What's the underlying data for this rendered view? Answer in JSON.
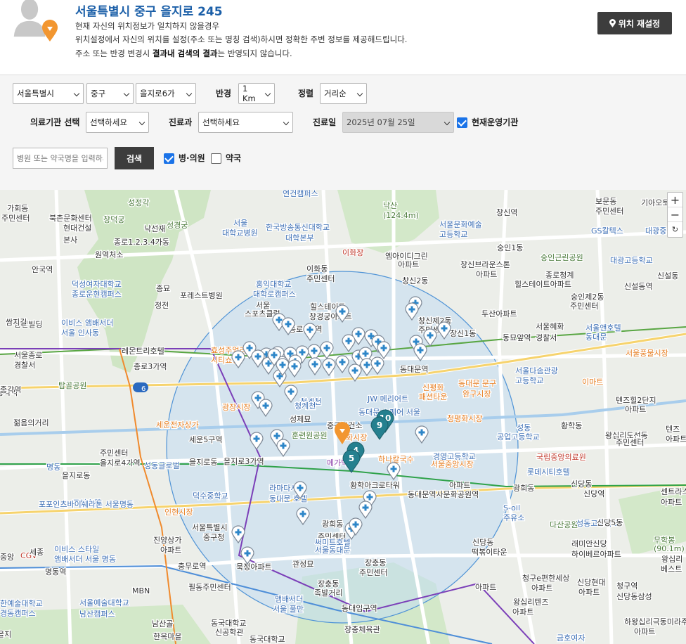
{
  "location": {
    "address": "서울특별시 중구 을지로 245",
    "line1": "현재 자신의 위치정보가 일치하지 않을경우",
    "line2": "위치설정에서 자신의 위치를 설정(주소 또는 명칭 검색)하시면 정확한 주변 정보를 제공해드립니다.",
    "line3_pre": "주소 또는 반경 변경시 ",
    "line3_bold": "결과내 검색의 결과",
    "line3_post": "는 반영되지 않습니다.",
    "reset_label": "위치 재설정"
  },
  "filters": {
    "sido": "서울특별시",
    "sigungu": "중구",
    "dong": "을지로6가",
    "radius_label": "반경",
    "radius": "1 Km",
    "sort_label": "정렬",
    "sort": "거리순",
    "institution_label": "의료기관 선택",
    "institution": "선택하세요",
    "dept_label": "진료과",
    "dept": "선택하세요",
    "date_label": "진료일",
    "date": "2025년 07월 25일",
    "operating_label": "현재운영기관",
    "search_placeholder": "병원 또는 약국명을 입력하세요",
    "search_button": "검색",
    "hospital_label": "병·의원",
    "pharmacy_label": "약국"
  },
  "map": {
    "zoom_in": "+",
    "zoom_out": "−",
    "reset": "↻",
    "labels": [
      {
        "t": "연건캠퍼스",
        "c": "#3d6fb5"
      },
      {
        "t": "낙산",
        "c": "#4a7a3a"
      },
      {
        "t": "(124.4m)",
        "c": "#4a7a3a"
      },
      {
        "t": "창신역",
        "c": "#333"
      },
      {
        "t": "보문동",
        "c": "#333"
      },
      {
        "t": "주민센터",
        "c": "#333"
      },
      {
        "t": "기아오토",
        "c": "#333"
      },
      {
        "t": "가회동",
        "c": "#333"
      },
      {
        "t": "주민센터",
        "c": "#333"
      },
      {
        "t": "성정각",
        "c": "#4a7a3a"
      },
      {
        "t": "창덕궁",
        "c": "#4a7a3a"
      },
      {
        "t": "북촌문화센터",
        "c": "#333"
      },
      {
        "t": "현대건설",
        "c": "#333"
      },
      {
        "t": "본사",
        "c": "#333"
      },
      {
        "t": "낙선재",
        "c": "#333"
      },
      {
        "t": "성경궁",
        "c": "#4a7a3a"
      },
      {
        "t": "서울",
        "c": "#3d6fb5"
      },
      {
        "t": "대학교병원",
        "c": "#3d6fb5"
      },
      {
        "t": "한국방송통신대학교",
        "c": "#3d6fb5"
      },
      {
        "t": "대학본부",
        "c": "#3d6fb5"
      },
      {
        "t": "서울문화예술",
        "c": "#3d6fb5"
      },
      {
        "t": "고등학교",
        "c": "#3d6fb5"
      },
      {
        "t": "숭인1동",
        "c": "#333"
      },
      {
        "t": "GS칼텍스",
        "c": "#3d6fb5"
      },
      {
        "t": "대광중",
        "c": "#3d6fb5"
      },
      {
        "t": "원역처소",
        "c": "#333"
      },
      {
        "t": "종로1.2.3.4가동",
        "c": "#333"
      },
      {
        "t": "이화장",
        "c": "#c0392b"
      },
      {
        "t": "엠아이디그린",
        "c": "#333"
      },
      {
        "t": "아파트",
        "c": "#333"
      },
      {
        "t": "창신브라운스톤",
        "c": "#333"
      },
      {
        "t": "아파트",
        "c": "#333"
      },
      {
        "t": "숭인근린공원",
        "c": "#4a7a3a"
      },
      {
        "t": "대광고등학교",
        "c": "#3d6fb5"
      },
      {
        "t": "안국역",
        "c": "#333"
      },
      {
        "t": "이화동",
        "c": "#333"
      },
      {
        "t": "주민센터",
        "c": "#333"
      },
      {
        "t": "창신2동",
        "c": "#333"
      },
      {
        "t": "힐스테이트아파트",
        "c": "#333"
      },
      {
        "t": "종로청계",
        "c": "#333"
      },
      {
        "t": "신설동역",
        "c": "#333"
      },
      {
        "t": "신설동",
        "c": "#333"
      },
      {
        "t": "덕성여자대학교",
        "c": "#3d6fb5"
      },
      {
        "t": "종로운현캠퍼스",
        "c": "#3d6fb5"
      },
      {
        "t": "종묘",
        "c": "#333"
      },
      {
        "t": "포레스트병원",
        "c": "#333"
      },
      {
        "t": "홍익대학교",
        "c": "#3d6fb5"
      },
      {
        "t": "대학로캠퍼스",
        "c": "#3d6fb5"
      },
      {
        "t": "숭인제2동",
        "c": "#333"
      },
      {
        "t": "주민센터",
        "c": "#333"
      },
      {
        "t": "정전",
        "c": "#333"
      },
      {
        "t": "서울",
        "c": "#333"
      },
      {
        "t": "스포츠클럽",
        "c": "#333"
      },
      {
        "t": "힐스테이트",
        "c": "#333"
      },
      {
        "t": "창경궁아파트",
        "c": "#333"
      },
      {
        "t": "두산아파트",
        "c": "#333"
      },
      {
        "t": "삼일빌딩",
        "c": "#333"
      },
      {
        "t": "이비스 앰배서더",
        "c": "#3d6fb5"
      },
      {
        "t": "서울 인사동",
        "c": "#3d6fb5"
      },
      {
        "t": "창신제2동",
        "c": "#333"
      },
      {
        "t": "주민센터",
        "c": "#333"
      },
      {
        "t": "창신1동",
        "c": "#333"
      },
      {
        "t": "서울혜화",
        "c": "#333"
      },
      {
        "t": "경찰서",
        "c": "#333"
      },
      {
        "t": "서울앤호텔",
        "c": "#3d6fb5"
      },
      {
        "t": "동대문",
        "c": "#3d6fb5"
      },
      {
        "t": "동묘앞역",
        "c": "#333"
      },
      {
        "t": "서울종로",
        "c": "#333"
      },
      {
        "t": "경찰서",
        "c": "#333"
      },
      {
        "t": "레몬트리호텔",
        "c": "#333"
      },
      {
        "t": "효성주얼리",
        "c": "#e67e22"
      },
      {
        "t": "시티쇼핑",
        "c": "#e67e22"
      },
      {
        "t": "종로5가역",
        "c": "#333"
      },
      {
        "t": "동대문역",
        "c": "#333"
      },
      {
        "t": "서울풍물시장",
        "c": "#e67e22"
      },
      {
        "t": "종로3가역",
        "c": "#333"
      },
      {
        "t": "서울다솜관광",
        "c": "#3d6fb5"
      },
      {
        "t": "고등학교",
        "c": "#3d6fb5"
      },
      {
        "t": "이마트",
        "c": "#e67e22"
      },
      {
        "t": "탑골공원",
        "c": "#4a7a3a"
      },
      {
        "t": "종각역",
        "c": "#333"
      },
      {
        "t": "광장시장",
        "c": "#e67e22"
      },
      {
        "t": "청계천",
        "c": "#3d6fb5"
      },
      {
        "t": "JW 메리어트",
        "c": "#3d6fb5"
      },
      {
        "t": "동대문 스퀘어 서울",
        "c": "#3d6fb5"
      },
      {
        "t": "신평화",
        "c": "#e67e22"
      },
      {
        "t": "패션타운",
        "c": "#e67e22"
      },
      {
        "t": "동대문 문구",
        "c": "#e67e22"
      },
      {
        "t": "완구시장",
        "c": "#e67e22"
      },
      {
        "t": "텐즈힐2단지",
        "c": "#333"
      },
      {
        "t": "아파트",
        "c": "#333"
      },
      {
        "t": "젊음의거리",
        "c": "#333"
      },
      {
        "t": "세운전자상가",
        "c": "#e67e22"
      },
      {
        "t": "성제묘",
        "c": "#333"
      },
      {
        "t": "중구보건소",
        "c": "#333"
      },
      {
        "t": "청평화시장",
        "c": "#e67e22"
      },
      {
        "t": "성동",
        "c": "#3d6fb5"
      },
      {
        "t": "공업고등학교",
        "c": "#3d6fb5"
      },
      {
        "t": "황학동",
        "c": "#333"
      },
      {
        "t": "왕십리도선동",
        "c": "#333"
      },
      {
        "t": "주민센터",
        "c": "#333"
      },
      {
        "t": "텐즈",
        "c": "#333"
      },
      {
        "t": "아파트",
        "c": "#333"
      },
      {
        "t": "청계천",
        "c": "#3d6fb5"
      },
      {
        "t": "세운5구역",
        "c": "#333"
      },
      {
        "t": "훈련원공원",
        "c": "#4a7a3a"
      },
      {
        "t": "평화시장",
        "c": "#e67e22"
      },
      {
        "t": "을지로동",
        "c": "#333"
      },
      {
        "t": "주민센터",
        "c": "#333"
      },
      {
        "t": "을지로4가역",
        "c": "#333"
      },
      {
        "t": "을지로3가역",
        "c": "#333"
      },
      {
        "t": "성동글로벌",
        "c": "#3d6fb5"
      },
      {
        "t": "경영고등학교",
        "c": "#3d6fb5"
      },
      {
        "t": "서울중앙시장",
        "c": "#e67e22"
      },
      {
        "t": "국립중앙의료원",
        "c": "#c0392b"
      },
      {
        "t": "메가박스",
        "c": "#8e44ad"
      },
      {
        "t": "하나칼국수",
        "c": "#e67e22"
      },
      {
        "t": "롯데시티호텔",
        "c": "#3d6fb5"
      },
      {
        "t": "명동",
        "c": "#3d6fb5"
      },
      {
        "t": "을지로동",
        "c": "#333"
      },
      {
        "t": "황학아크로타워",
        "c": "#333"
      },
      {
        "t": "아파트",
        "c": "#333"
      },
      {
        "t": "광희동",
        "c": "#333"
      },
      {
        "t": "신당동",
        "c": "#333"
      },
      {
        "t": "신당역",
        "c": "#333"
      },
      {
        "t": "센트라스",
        "c": "#333"
      },
      {
        "t": "아파트",
        "c": "#333"
      },
      {
        "t": "조선호텔",
        "c": "#3d6fb5"
      },
      {
        "t": "포포인츠바이쉐라톤 서울명동",
        "c": "#3d6fb5"
      },
      {
        "t": "덕수중학교",
        "c": "#3d6fb5"
      },
      {
        "t": "라마다서울",
        "c": "#3d6fb5"
      },
      {
        "t": "동대문 호텔",
        "c": "#3d6fb5"
      },
      {
        "t": "동대문역사문화공원역",
        "c": "#333"
      },
      {
        "t": "다산공원",
        "c": "#4a7a3a"
      },
      {
        "t": "성동고등학교",
        "c": "#3d6fb5"
      },
      {
        "t": "신당5동",
        "c": "#333"
      },
      {
        "t": "S-oil",
        "c": "#3d6fb5"
      },
      {
        "t": "주유소",
        "c": "#3d6fb5"
      },
      {
        "t": "인현시장",
        "c": "#e67e22"
      },
      {
        "t": "광희동",
        "c": "#333"
      },
      {
        "t": "주민센터",
        "c": "#333"
      },
      {
        "t": "이비스 스타일",
        "c": "#3d6fb5"
      },
      {
        "t": "앰배서더 서울 명동",
        "c": "#3d6fb5"
      },
      {
        "t": "서울특별시",
        "c": "#333"
      },
      {
        "t": "중구청",
        "c": "#333"
      },
      {
        "t": "써미트호텔",
        "c": "#3d6fb5"
      },
      {
        "t": "서울동대문",
        "c": "#3d6fb5"
      },
      {
        "t": "진양상가",
        "c": "#333"
      },
      {
        "t": "아파트",
        "c": "#333"
      },
      {
        "t": "래미안신당",
        "c": "#333"
      },
      {
        "t": "하이베르아파트",
        "c": "#333"
      },
      {
        "t": "무학봉",
        "c": "#4a7a3a"
      },
      {
        "t": "(90.1m)",
        "c": "#4a7a3a"
      },
      {
        "t": "신당동",
        "c": "#333"
      },
      {
        "t": "떡볶이타운",
        "c": "#333"
      },
      {
        "t": "충무로역",
        "c": "#333"
      },
      {
        "t": "장충동",
        "c": "#333"
      },
      {
        "t": "주민센터",
        "c": "#333"
      },
      {
        "t": "관성묘",
        "c": "#333"
      },
      {
        "t": "왕십리",
        "c": "#333"
      },
      {
        "t": "베스트",
        "c": "#333"
      },
      {
        "t": "명동역",
        "c": "#333"
      },
      {
        "t": "CGV",
        "c": "#c0392b"
      },
      {
        "t": "서울예술대학교",
        "c": "#3d6fb5"
      },
      {
        "t": "남산캠퍼스",
        "c": "#3d6fb5"
      },
      {
        "t": "필동주민센터",
        "c": "#333"
      },
      {
        "t": "장충동",
        "c": "#333"
      },
      {
        "t": "족발거리",
        "c": "#333"
      },
      {
        "t": "청구e편한세상",
        "c": "#333"
      },
      {
        "t": "아파트",
        "c": "#333"
      },
      {
        "t": "신당현대",
        "c": "#333"
      },
      {
        "t": "아파트",
        "c": "#333"
      },
      {
        "t": "청구역",
        "c": "#333"
      },
      {
        "t": "신당동삼성",
        "c": "#333"
      },
      {
        "t": "아파트",
        "c": "#333"
      },
      {
        "t": "왕십리텐즈",
        "c": "#333"
      },
      {
        "t": "아파트",
        "c": "#333"
      },
      {
        "t": "MBN",
        "c": "#333"
      },
      {
        "t": "남산골",
        "c": "#333"
      },
      {
        "t": "한옥마을",
        "c": "#333"
      },
      {
        "t": "동국대학교",
        "c": "#333"
      },
      {
        "t": "신공학관",
        "c": "#333"
      },
      {
        "t": "앰배서더",
        "c": "#3d6fb5"
      },
      {
        "t": "서울 풀만",
        "c": "#3d6fb5"
      },
      {
        "t": "동대입구역",
        "c": "#333"
      },
      {
        "t": "하왕십리극동미라주",
        "c": "#333"
      },
      {
        "t": "아파트",
        "c": "#333"
      },
      {
        "t": "동국대학교",
        "c": "#333"
      },
      {
        "t": "장충체육관",
        "c": "#333"
      },
      {
        "t": "금호여자",
        "c": "#3d6fb5"
      },
      {
        "t": "한예술대학교",
        "c": "#3d6fb5"
      },
      {
        "t": "경동캠퍼스",
        "c": "#3d6fb5"
      },
      {
        "t": "묵정아파트",
        "c": "#333"
      },
      {
        "t": "세종",
        "c": "#333"
      },
      {
        "t": "중앙",
        "c": "#333"
      },
      {
        "t": "을지",
        "c": "#333"
      },
      {
        "t": "쌈지길",
        "c": "#333"
      },
      {
        "t": "종각역",
        "c": "#333"
      },
      {
        "t": "6",
        "c": "#fff"
      }
    ],
    "cluster_badges": [
      "10",
      "9",
      "4",
      "5"
    ]
  }
}
